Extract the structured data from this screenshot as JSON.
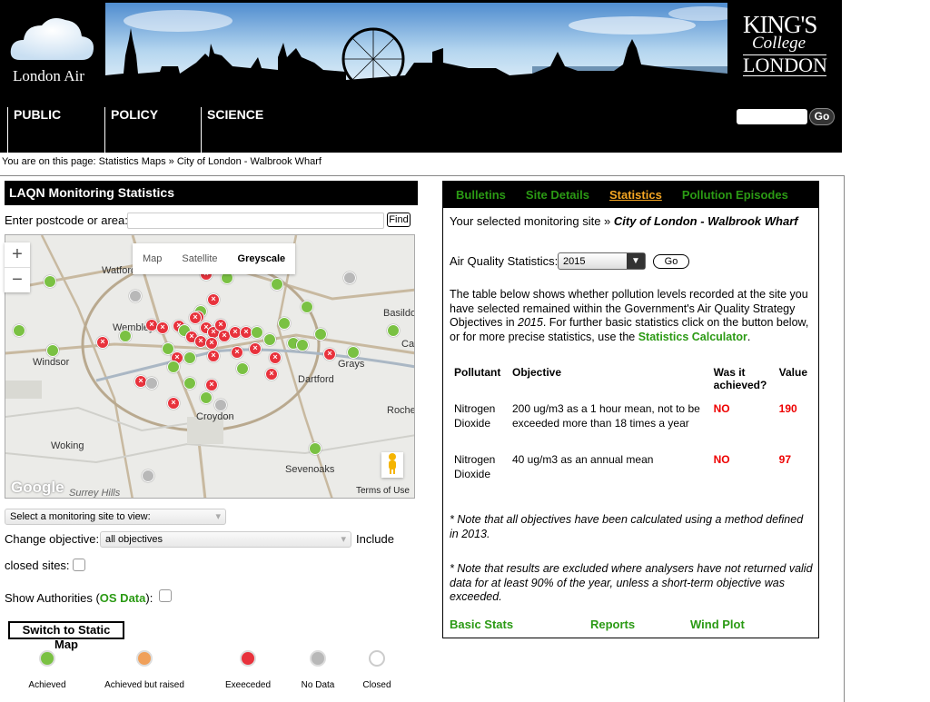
{
  "header": {
    "logo_text": "London Air",
    "kcl_line1": "KING'S",
    "kcl_line2": "College",
    "kcl_line3": "LONDON",
    "nav": [
      "PUBLIC",
      "POLICY",
      "SCIENCE"
    ],
    "search_button": "Go"
  },
  "breadcrumb": "You are on this page: Statistics Maps » City of London - Walbrook Wharf",
  "left": {
    "title": "LAQN Monitoring Statistics",
    "postcode_label": "Enter postcode or area:",
    "find_button": "Find",
    "map_types": [
      "Map",
      "Satellite",
      "Greyscale"
    ],
    "map_labels": [
      "Watford",
      "Wembley",
      "Windsor",
      "Dartford",
      "Grays",
      "Croydon",
      "Woking",
      "Sevenoaks",
      "Surrey Hills",
      "Basildon",
      "Rochester",
      "Canvey"
    ],
    "google_text": "Google",
    "terms_text": "Terms of Use",
    "select_site": "Select a monitoring site to view:",
    "change_objective_label": "Change objective:",
    "objective_value": "all objectives",
    "include_label": "Include",
    "closed_sites_label": "closed sites:",
    "show_authorities_pre": "Show Authorities (",
    "os_data": "OS Data",
    "show_authorities_post": "):",
    "static_map_button": "Switch to Static Map",
    "legend": [
      {
        "label": "Achieved",
        "color": "#7ac143"
      },
      {
        "label": "Achieved but raised",
        "color": "#f0a05a"
      },
      {
        "label": "Exeeceded",
        "color": "#e8323c"
      },
      {
        "label": "No Data",
        "color": "#b8b8b8"
      },
      {
        "label": "Closed",
        "color": "#ffffff"
      }
    ]
  },
  "right": {
    "tabs": [
      "Bulletins",
      "Site Details",
      "Statistics",
      "Pollution Episodes"
    ],
    "selected_site_prefix": "Your selected monitoring site »",
    "selected_site": "City of London - Walbrook Wharf",
    "aq_stats_label": "Air Quality Statistics:",
    "year": "2015",
    "go_button": "Go",
    "intro_1": "The table below shows whether pollution levels recorded at the site you have selected remained within the Government's Air Quality Strategy Objectives in ",
    "intro_year": "2015",
    "intro_2": ". For further basic statistics click on the button below, or for more precise statistics, use the ",
    "stats_calc": "Statistics Calculator",
    "intro_3": ".",
    "table_headers": [
      "Pollutant",
      "Objective",
      "Was it achieved?",
      "Value"
    ],
    "rows": [
      {
        "pollutant": "Nitrogen Dioxide",
        "objective": "200 ug/m3 as a 1 hour mean, not to be exceeded more than 18 times a year",
        "achieved": "NO",
        "value": "190"
      },
      {
        "pollutant": "Nitrogen Dioxide",
        "objective": "40 ug/m3 as an annual mean",
        "achieved": "NO",
        "value": "97"
      }
    ],
    "note_1": "* Note that all objectives have been calculated using a method defined in 2013.",
    "note_2": "* Note that results are excluded where analysers have not returned valid data for at least 90% of the year, unless a short-term objective was exceeded.",
    "links": [
      "Basic Stats",
      "Reports",
      "Wind Plot"
    ]
  }
}
